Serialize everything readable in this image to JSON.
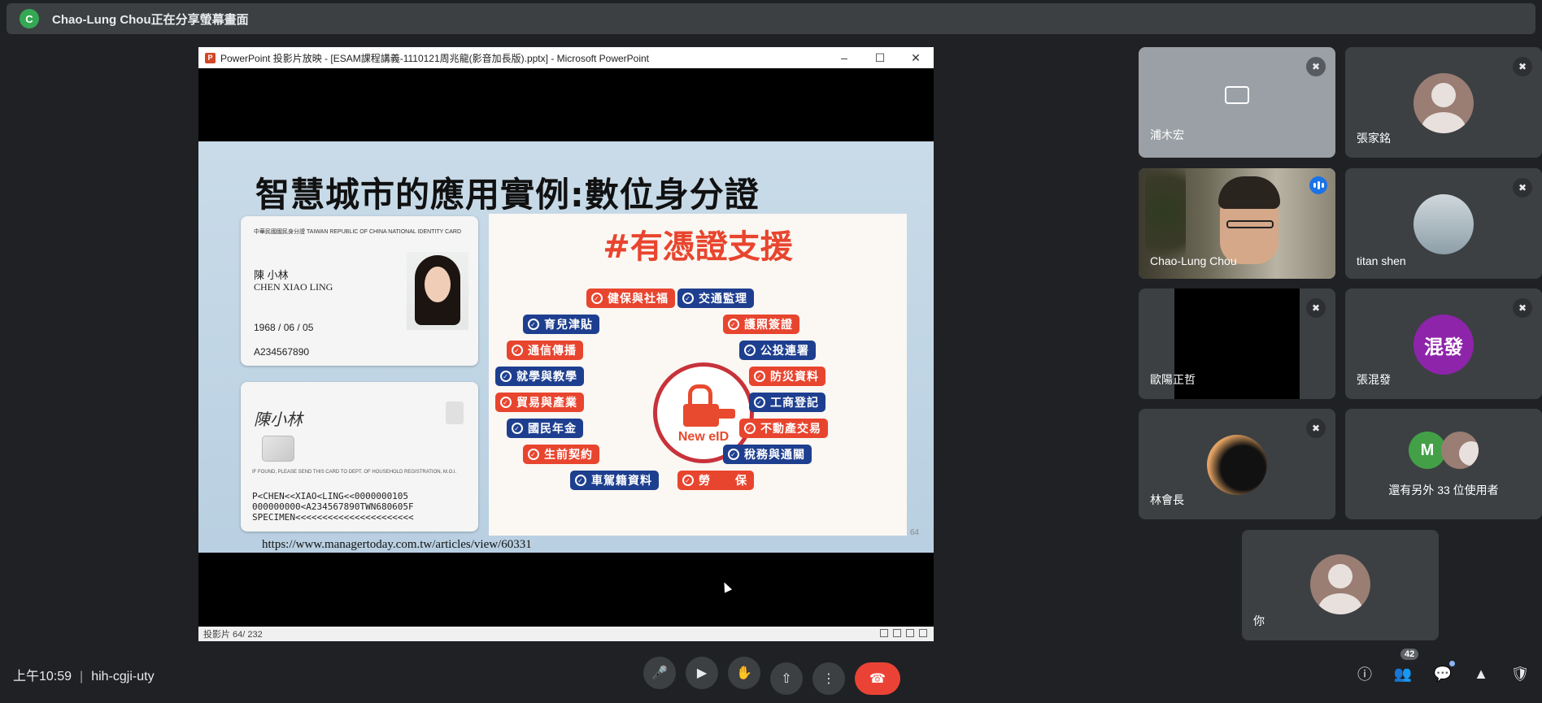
{
  "banner": {
    "badge_letter": "C",
    "text": "Chao-Lung Chou正在分享螢幕畫面"
  },
  "presentation": {
    "window_title": "PowerPoint 投影片放映 - [ESAM課程講義-1110121周兆龍(影音加長版).pptx] - Microsoft PowerPoint",
    "slide_title": "智慧城市的應用實例:數位身分證",
    "hashtag": "#有憑證支援",
    "center_label": "New eID",
    "url": "https://www.managertoday.com.tw/articles/view/60331",
    "page_number": "64",
    "status": "投影片 64/ 232",
    "id_card": {
      "header": "中華民國國民身分證 TAIWAN REPUBLIC OF CHINA     NATIONAL IDENTITY CARD",
      "name_cn": "陳 小林",
      "name_en": "CHEN XIAO LING",
      "dob": "1968 / 06 / 05",
      "id_no": "A234567890",
      "signature": "陳小林",
      "mrz": "P<CHEN<<XIAO<LING<<0000000105\n000000000<A234567890TWN680605F\nSPECIMEN<<<<<<<<<<<<<<<<<<<<<<",
      "back_notice": "IF FOUND, PLEASE SEND THIS CARD TO DEPT. OF HOUSEHOLD REGISTRATION, M.O.I."
    },
    "left_items": [
      "健保與社福",
      "育兒津貼",
      "通信傳播",
      "就學與教學",
      "貿易與產業",
      "國民年金",
      "生前契約",
      "車駕籍資料"
    ],
    "right_items": [
      "交通監理",
      "護照簽證",
      "公投連署",
      "防災資料",
      "工商登記",
      "不動產交易",
      "稅務與通關",
      "勞　　保"
    ]
  },
  "participants": [
    {
      "name": "浦木宏",
      "muted": true
    },
    {
      "name": "張家銘",
      "muted": true
    },
    {
      "name": "Chao-Lung Chou",
      "speaking": true
    },
    {
      "name": "titan shen",
      "muted": true
    },
    {
      "name": "歐陽正哲",
      "muted": true
    },
    {
      "name": "張混發",
      "muted": true,
      "avatar_text": "混發"
    },
    {
      "name": "林會長",
      "muted": true
    },
    {
      "name": "還有另外 33 位使用者",
      "avatar_letter": "M"
    },
    {
      "name": "你"
    }
  ],
  "bottombar": {
    "time": "上午10:59",
    "meeting_code": "hih-cgji-uty",
    "people_count": "42"
  },
  "colors": {
    "background": "#202124",
    "tile": "#3c4043",
    "hangup": "#ea4335",
    "accent": "#8ab4f8",
    "pill_red": "#e8452f",
    "pill_blue": "#1e3f8f"
  }
}
